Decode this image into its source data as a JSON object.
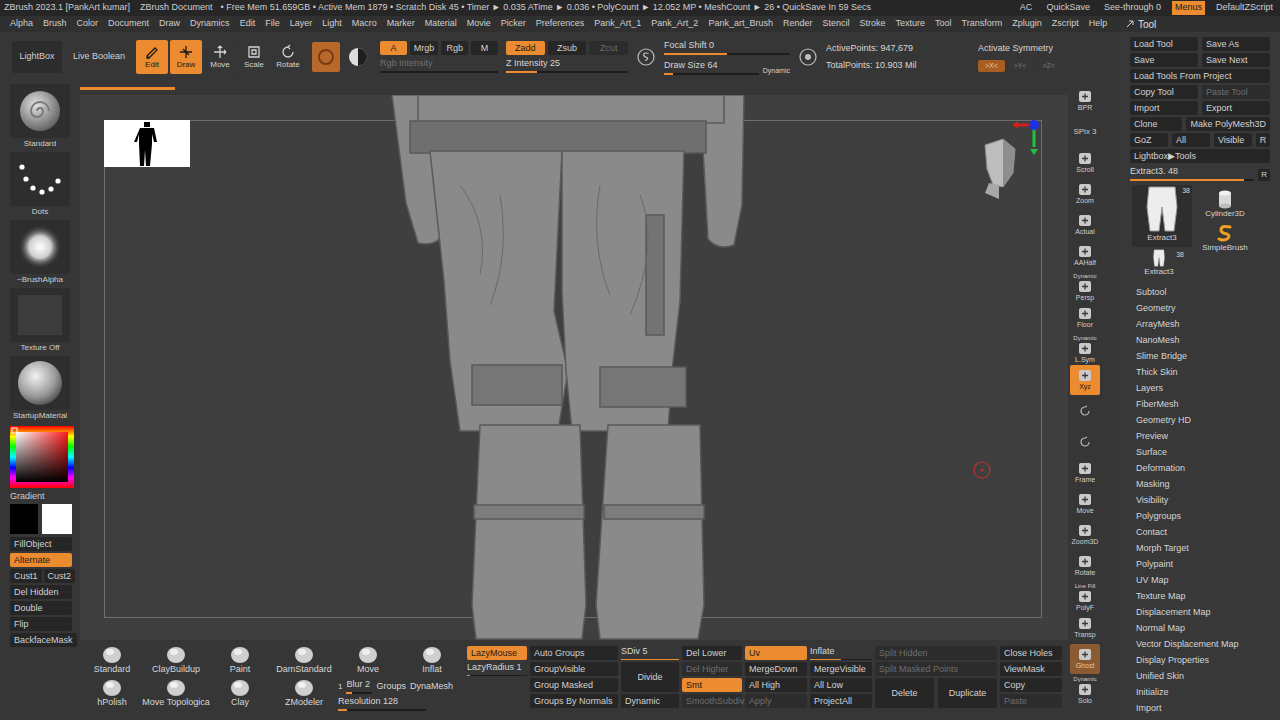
{
  "titlebar": {
    "app": "ZBrush 2023.1 [PankArt kumar]",
    "document": "ZBrush Document",
    "stats": "• Free Mem 51.659GB • Active Mem 1879 • Scratch Disk 45 • Timer ► 0.035 ATime ► 0.036 • PolyCount ► 12.052 MP • MeshCount ► 26 • QuickSave In 59 Secs",
    "right": [
      {
        "label": "AC",
        "selected": false
      },
      {
        "label": "QuickSave",
        "selected": false
      },
      {
        "label": "See-through  0",
        "selected": false
      },
      {
        "label": "Menus",
        "selected": true
      },
      {
        "label": "DefaultZScript",
        "selected": false
      }
    ]
  },
  "menu": [
    "Alpha",
    "Brush",
    "Color",
    "Document",
    "Draw",
    "Dynamics",
    "Edit",
    "File",
    "Layer",
    "Light",
    "Macro",
    "Marker",
    "Material",
    "Movie",
    "Picker",
    "Preferences",
    "Pank_Art_1",
    "Pank_Art_2",
    "Pank_art_Brush",
    "Render",
    "Stencil",
    "Stroke",
    "Texture",
    "Tool",
    "Transform",
    "Zplugin",
    "Zscript",
    "Help"
  ],
  "topShelf": {
    "lightbox": "LightBox",
    "liveBoolean": "Live Boolean",
    "modes": [
      {
        "label": "Edit",
        "selected": true
      },
      {
        "label": "Draw",
        "selected": true
      },
      {
        "label": "Move",
        "selected": false
      },
      {
        "label": "Scale",
        "selected": false
      },
      {
        "label": "Rotate",
        "selected": false
      }
    ],
    "strokeIcons": [
      {
        "selected": true
      },
      {
        "selected": false
      }
    ],
    "channels": [
      {
        "label": "A",
        "selected": true,
        "disabled": false
      },
      {
        "label": "Mrgb",
        "selected": false,
        "disabled": false
      },
      {
        "label": "Rgb",
        "selected": false,
        "disabled": false
      },
      {
        "label": "M",
        "selected": false,
        "disabled": false
      }
    ],
    "rgbIntensity": {
      "label": "Rgb Intensity",
      "level": 0,
      "disabled": true
    },
    "zmodes": [
      {
        "label": "Zadd",
        "selected": true,
        "disabled": false
      },
      {
        "label": "Zsub",
        "selected": false,
        "disabled": false
      },
      {
        "label": "Zcut",
        "selected": false,
        "disabled": true
      }
    ],
    "zIntensity": {
      "label": "Z Intensity 25",
      "level": 0.25,
      "disabled": false
    },
    "focalShift": {
      "label": "Focal Shift 0",
      "level": 0.5,
      "disabled": false
    },
    "drawSize": {
      "label": "Draw Size 64",
      "level": 0.1,
      "disabled": false
    },
    "dynamic": "Dynamic",
    "activePoints": "ActivePoints: 947,679",
    "totalPoints": "TotalPoints: 10.903 Mil",
    "symmetry": {
      "label": "Activate Symmetry",
      "axes": [
        {
          "label": ">X<",
          "selected": true
        },
        {
          "label": ">Y<",
          "selected": false
        },
        {
          "label": ">Z<",
          "selected": false
        }
      ]
    }
  },
  "leftShelf": {
    "thumbs": [
      {
        "label": "Standard",
        "kind": "brush"
      },
      {
        "label": "Dots",
        "kind": "stroke"
      },
      {
        "label": "~BrushAlpha",
        "kind": "alpha"
      },
      {
        "label": "Texture Off",
        "kind": "texture"
      },
      {
        "label": "StartupMaterial",
        "kind": "material"
      }
    ],
    "gradient": "Gradient",
    "swatches": [
      {
        "color": "#000000"
      },
      {
        "color": "#ffffff"
      }
    ],
    "buttons": [
      [
        {
          "label": "FillObject",
          "selected": false
        }
      ],
      [
        {
          "label": "Alternate",
          "selected": true
        }
      ],
      [
        {
          "label": "Cust1",
          "selected": false
        },
        {
          "label": "Cust2",
          "selected": false
        }
      ],
      [
        {
          "label": "Del Hidden",
          "selected": false
        }
      ],
      [
        {
          "label": "Double",
          "selected": false
        }
      ],
      [
        {
          "label": "Flip",
          "selected": false
        }
      ],
      [
        {
          "label": "BackfaceMask",
          "selected": false
        }
      ]
    ]
  },
  "rightBar": [
    {
      "kind": "tool",
      "top": "",
      "label": "BPR",
      "selected": false
    },
    {
      "kind": "text",
      "top": "",
      "label": "SPix 3",
      "selected": false
    },
    {
      "kind": "tool",
      "top": "",
      "label": "Scroll",
      "selected": false
    },
    {
      "kind": "tool",
      "top": "",
      "label": "Zoom",
      "selected": false
    },
    {
      "kind": "tool",
      "top": "",
      "label": "Actual",
      "selected": false
    },
    {
      "kind": "tool",
      "top": "",
      "label": "AAHalf",
      "selected": false
    },
    {
      "kind": "tool",
      "top": "Dynamic",
      "label": "Persp",
      "selected": false
    },
    {
      "kind": "tool",
      "top": "",
      "label": "Floor",
      "selected": false
    },
    {
      "kind": "tool",
      "top": "Dynamic",
      "label": "L.Sym",
      "selected": false
    },
    {
      "kind": "tool",
      "top": "",
      "label": "Xyz",
      "selected": true
    },
    {
      "kind": "small",
      "top": "",
      "label": "",
      "selected": false
    },
    {
      "kind": "small",
      "top": "",
      "label": "",
      "selected": false
    },
    {
      "kind": "tool",
      "top": "",
      "label": "Frame",
      "selected": false
    },
    {
      "kind": "tool",
      "top": "",
      "label": "Move",
      "selected": false
    },
    {
      "kind": "tool",
      "top": "",
      "label": "Zoom3D",
      "selected": false
    },
    {
      "kind": "tool",
      "top": "",
      "label": "Rotate",
      "selected": false
    },
    {
      "kind": "tool",
      "top": "Line Fill",
      "label": "PolyF",
      "selected": false
    },
    {
      "kind": "tool",
      "top": "",
      "label": "Transp",
      "selected": false
    },
    {
      "kind": "tool",
      "top": "",
      "label": "Ghost",
      "selected": true
    },
    {
      "kind": "tool",
      "top": "Dynamic",
      "label": "Solo",
      "selected": false
    }
  ],
  "tool": {
    "title": "Tool",
    "buttons": [
      [
        {
          "label": "Load Tool",
          "disabled": false
        },
        {
          "label": "Save As",
          "disabled": false
        }
      ],
      [
        {
          "label": "Save",
          "disabled": false
        },
        {
          "label": "Save Next",
          "disabled": false
        }
      ],
      [
        {
          "label": "Load Tools From Project",
          "disabled": false
        }
      ],
      [
        {
          "label": "Copy Tool",
          "disabled": false
        },
        {
          "label": "Paste Tool",
          "disabled": true
        }
      ],
      [
        {
          "label": "Import",
          "disabled": false
        },
        {
          "label": "Export",
          "disabled": false
        }
      ],
      [
        {
          "label": "Clone",
          "disabled": false
        },
        {
          "label": "Make PolyMesh3D",
          "disabled": false
        }
      ],
      [
        {
          "label": "GoZ",
          "disabled": false
        },
        {
          "label": "All",
          "disabled": false
        },
        {
          "label": "Visible",
          "disabled": false
        },
        {
          "label": "R",
          "disabled": false
        }
      ],
      [
        {
          "label": "Lightbox▶Tools",
          "disabled": false
        }
      ]
    ],
    "current": {
      "label": "Extract3. 48",
      "level": 0.92,
      "reset": "R"
    },
    "thumbs": [
      {
        "label": "Extract3",
        "count": "38",
        "kind": "pants"
      },
      {
        "label": "Cylinder3D",
        "count": "",
        "kind": "cylinder"
      },
      {
        "label": "SimpleBrush",
        "count": "",
        "kind": "brush"
      },
      {
        "label": "Extract3",
        "count": "38",
        "kind": "pants"
      }
    ],
    "sections": [
      "Subtool",
      "Geometry",
      "ArrayMesh",
      "NanoMesh",
      "Slime Bridge",
      "Thick Skin",
      "Layers",
      "FiberMesh",
      "Geometry HD",
      "Preview",
      "Surface",
      "Deformation",
      "Masking",
      "Visibility",
      "Polygroups",
      "Contact",
      "Morph Target",
      "Polypaint",
      "UV Map",
      "Texture Map",
      "Displacement Map",
      "Normal Map",
      "Vector Displacement Map",
      "Display Properties",
      "Unified Skin",
      "Initialize",
      "Import"
    ]
  },
  "bottomShelf": {
    "brushes": [
      [
        "Standard",
        "ClayBuildup",
        "Paint",
        "DamStandard",
        "Move",
        "Inflat"
      ],
      [
        "hPolish",
        "Move Topologica",
        "Clay",
        "ZModeler"
      ]
    ],
    "dynamesh": {
      "blur": {
        "label": "Blur 2",
        "level": 0.2,
        "disabled": false
      },
      "groupsValue": "1",
      "groups": "Groups",
      "dynamesh": "DynaMesh",
      "resolution": {
        "label": "Resolution 128",
        "level": 0.1,
        "disabled": false
      }
    },
    "columns": [
      [
        {
          "kind": "button",
          "label": "LazyMouse",
          "selected": true,
          "disabled": false
        },
        {
          "kind": "slider",
          "label": "LazyRadius 1",
          "level": 0.05,
          "selected": false,
          "disabled": false
        }
      ],
      [
        {
          "kind": "button",
          "label": "Auto Groups",
          "selected": false,
          "disabled": false
        },
        {
          "kind": "button",
          "label": "GroupVisible",
          "selected": false,
          "disabled": false
        },
        {
          "kind": "button",
          "label": "Group Masked",
          "selected": false,
          "disabled": false
        },
        {
          "kind": "button",
          "label": "Groups By Normals",
          "selected": false,
          "disabled": false
        }
      ],
      [
        {
          "kind": "slider",
          "label": "SDiv 5",
          "level": 1,
          "selected": false,
          "disabled": false
        },
        {
          "kind": "tall",
          "label": "Divide",
          "selected": false,
          "disabled": false
        },
        {
          "kind": "button",
          "label": "Dynamic",
          "selected": false,
          "disabled": false
        }
      ],
      [
        {
          "kind": "button",
          "label": "Del Lower",
          "selected": false,
          "disabled": false
        },
        {
          "kind": "button",
          "label": "Del Higher",
          "selected": false,
          "disabled": true
        },
        {
          "kind": "button",
          "label": "Smt",
          "selected": true,
          "disabled": false
        },
        {
          "kind": "button",
          "label": "SmoothSubdiv",
          "selected": false,
          "disabled": true
        }
      ],
      [
        {
          "kind": "button",
          "label": "Uv",
          "selected": true,
          "disabled": false
        },
        {
          "kind": "button",
          "label": "MergeDown",
          "selected": false,
          "disabled": false
        },
        {
          "kind": "button",
          "label": "All High",
          "selected": false,
          "disabled": false
        },
        {
          "kind": "button",
          "label": "Apply",
          "selected": false,
          "disabled": true
        }
      ],
      [
        {
          "kind": "slider",
          "label": "Inflate",
          "level": 0.5,
          "selected": false,
          "disabled": false
        },
        {
          "kind": "button",
          "label": "MergeVisible",
          "selected": false,
          "disabled": false
        },
        {
          "kind": "button",
          "label": "All Low",
          "selected": false,
          "disabled": false
        },
        {
          "kind": "button",
          "label": "ProjectAll",
          "selected": false,
          "disabled": false
        }
      ],
      [
        {
          "kind": "button",
          "label": "Split Hidden",
          "selected": false,
          "disabled": true
        },
        {
          "kind": "button",
          "label": "Split Masked Points",
          "selected": false,
          "disabled": true
        },
        {
          "kind": "pair",
          "label": "Delete",
          "selected": false,
          "disabled": false
        },
        {
          "kind": "pair",
          "label": "Duplicate",
          "selected": false,
          "disabled": false
        }
      ],
      [
        {
          "kind": "button",
          "label": "Close Holes",
          "selected": false,
          "disabled": false
        },
        {
          "kind": "button",
          "label": "ViewMask",
          "selected": false,
          "disabled": false
        },
        {
          "kind": "button",
          "label": "Copy",
          "selected": false,
          "disabled": false
        },
        {
          "kind": "button",
          "label": "Paste",
          "selected": false,
          "disabled": true
        }
      ]
    ]
  }
}
